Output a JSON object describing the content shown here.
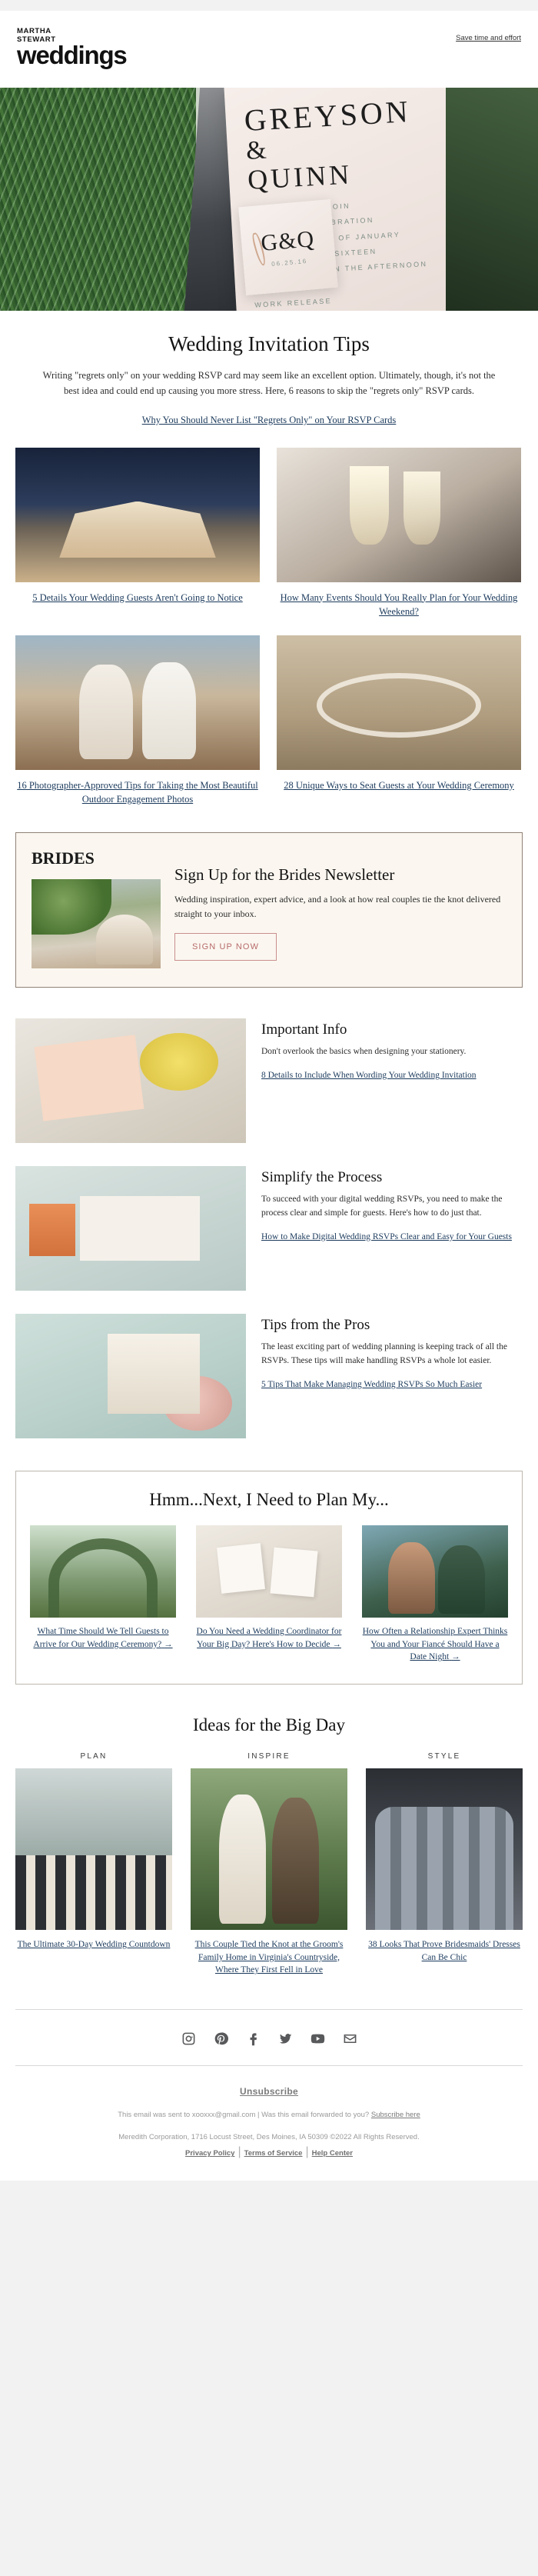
{
  "brand": {
    "kicker_line1": "MARTHA",
    "kicker_line2": "STEWART",
    "wordmark": "weddings",
    "top_link": "Save time and effort"
  },
  "hero": {
    "name1": "GREYSON",
    "amp": "&",
    "name2": "QUINN",
    "monogram": "G&Q",
    "monogram_date": "06.25.16",
    "detail_lines": "INVITE YOU TO JOIN\nMARRIAGE CELEBRATION\nTWENTY FOURTH OF JANUARY\nTWO THOUSAND SIXTEEN\nFOUR O'CLOCK IN THE AFTERNOON\n\nWORK RELEASE"
  },
  "intro": {
    "title": "Wedding Invitation Tips",
    "body": "Writing \"regrets only\" on your wedding RSVP card may seem like an excellent option. Ultimately, though, it's not the best idea and could end up causing you more stress. Here, 6 reasons to skip the \"regrets only\" RSVP cards.",
    "cta": "Why You Should Never List \"Regrets Only\" on Your RSVP Cards"
  },
  "grid": [
    {
      "caption": "5 Details Your Wedding Guests Aren't Going to Notice",
      "image": "tent-reception-photo"
    },
    {
      "caption": "How Many Events Should You Really Plan for Your Wedding Weekend?",
      "image": "champagne-toast-photo"
    },
    {
      "caption": "16 Photographer-Approved Tips for Taking the Most Beautiful Outdoor Engagement Photos",
      "image": "engaged-couple-cliff-photo"
    },
    {
      "caption": "28 Unique Ways to Seat Guests at Your Wedding Ceremony",
      "image": "circular-ceremony-seating-photo"
    }
  ],
  "promo": {
    "brand": "BRIDES",
    "title": "Sign Up for the Brides Newsletter",
    "body": "Wedding inspiration, expert advice, and a look at how real couples tie the knot delivered straight to your inbox.",
    "button": "SIGN UP NOW",
    "image": "outdoor-wedding-arch-photo",
    "border_color": "#8f8177",
    "background_color": "#fbf7f0",
    "button_color": "#b86a6a"
  },
  "rows": [
    {
      "title": "Important Info",
      "body": "Don't overlook the basics when designing your stationery.",
      "link": "8 Details to Include When Wording Your Wedding Invitation",
      "image": "stationery-flatlay-photo"
    },
    {
      "title": "Simplify the Process",
      "body": "To succeed with your digital wedding RSVPs, you need to make the process clear and simple for guests. Here's how to do just that.",
      "link": "How to Make Digital Wedding RSVPs Clear and Easy for Your Guests",
      "image": "rsvp-card-photo"
    },
    {
      "title": "Tips from the Pros",
      "body": "The least exciting part of wedding planning is keeping track of all the RSVPs. These tips will make handling RSVPs a whole lot easier.",
      "link": "5 Tips That Make Managing Wedding RSVPs So Much Easier",
      "image": "wedding-table-setting-photo"
    }
  ],
  "plan": {
    "title": "Hmm...Next, I Need to Plan My...",
    "items": [
      {
        "caption": "What Time Should We Tell Guests to Arrive for Our Wedding Ceremony?",
        "arrow": "→",
        "image": "floral-arch-photo"
      },
      {
        "caption": "Do You Need a Wedding Coordinator for Your Big Day? Here's How to Decide",
        "arrow": "→",
        "image": "escort-cards-photo"
      },
      {
        "caption": "How Often a Relationship Expert Thinks You and Your Fiancé Should Have a Date Night",
        "arrow": "→",
        "image": "couple-embrace-photo"
      }
    ]
  },
  "ideas": {
    "title": "Ideas for the Big Day",
    "items": [
      {
        "label": "PLAN",
        "caption": "The Ultimate 30-Day Wedding Countdown",
        "image": "wedding-party-lineup-photo"
      },
      {
        "label": "INSPIRE",
        "caption": "This Couple Tied the Knot at the Groom's Family Home in Virginia's Countryside, Where They First Fell in Love",
        "image": "bride-groom-kiss-photo"
      },
      {
        "label": "STYLE",
        "caption": "38 Looks That Prove Bridesmaids' Dresses Can Be Chic",
        "image": "bridesmaids-dresses-photo"
      }
    ]
  },
  "social": [
    {
      "name": "instagram",
      "label": "Instagram"
    },
    {
      "name": "pinterest",
      "label": "Pinterest"
    },
    {
      "name": "facebook",
      "label": "Facebook"
    },
    {
      "name": "twitter",
      "label": "Twitter"
    },
    {
      "name": "youtube",
      "label": "YouTube"
    },
    {
      "name": "email",
      "label": "Email"
    }
  ],
  "footer": {
    "unsubscribe": "Unsubscribe",
    "sent_to_prefix": "This email was sent to ",
    "recipient": "xooxxx@gmail.com",
    "divider": " | ",
    "forward_text": "Was this email forwarded to you? ",
    "subscribe_link": "Subscribe here",
    "address": "Meredith Corporation, 1716 Locust Street, Des Moines, IA 50309 ©2022 All Rights Reserved.",
    "privacy": "Privacy Policy",
    "terms": "Terms of Service",
    "help": "Help Center"
  }
}
